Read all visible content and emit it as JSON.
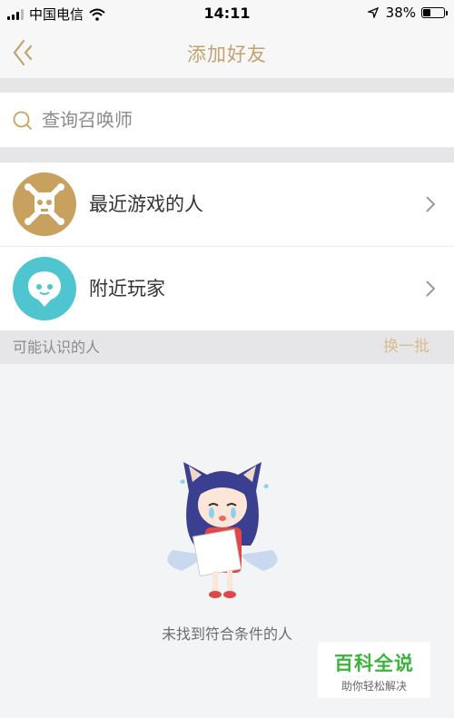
{
  "status_bar": {
    "carrier": "中国电信",
    "time": "14:11",
    "battery": "38%",
    "battery_level": 0.38
  },
  "nav": {
    "title": "添加好友"
  },
  "search": {
    "placeholder": "查询召唤师"
  },
  "list": [
    {
      "label": "最近游戏的人"
    },
    {
      "label": "附近玩家"
    }
  ],
  "section": {
    "title": "可能认识的人",
    "action": "换一批"
  },
  "empty_state": {
    "text": "未找到符合条件的人"
  },
  "watermark": {
    "title": "百科全说",
    "subtitle": "助你轻松解决"
  },
  "colors": {
    "accent": "#c0a36e",
    "gold": "#c9a15f",
    "teal": "#4fc6cf"
  }
}
